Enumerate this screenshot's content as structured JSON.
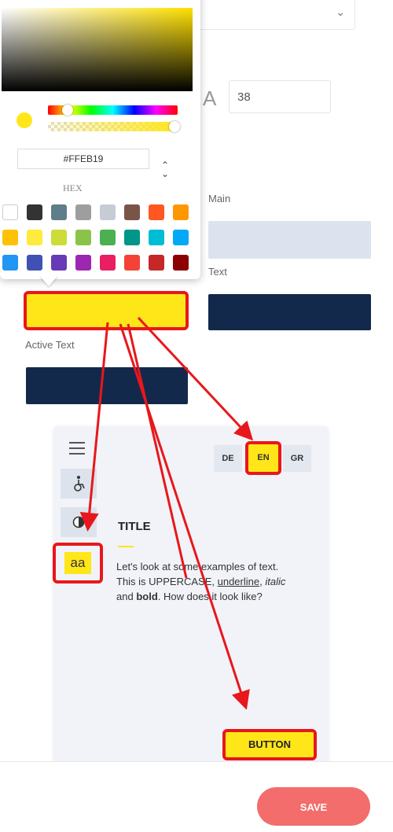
{
  "settings": {
    "size_icon_letter": "A",
    "size_value": "38",
    "labels": {
      "main": "Main",
      "text": "Text",
      "active_text": "Active Text"
    },
    "colors": {
      "active_background": "#ffe619",
      "main": "#dde3ee",
      "text": "#13294b",
      "active_text": "#13294b",
      "annotation_red": "#e8171b"
    }
  },
  "color_picker": {
    "hex_value": "#FFEB19",
    "mode_label": "HEX",
    "palette": [
      "#ffffff",
      "#333333",
      "#607d8b",
      "#9e9e9e",
      "#c5ccd3",
      "#795548",
      "#ff5722",
      "#ff9800",
      "#ffc107",
      "#ffeb3b",
      "#cddc39",
      "#8bc34a",
      "#4caf50",
      "#009688",
      "#00bcd4",
      "#03a9f4",
      "#2196f3",
      "#3f51b5",
      "#673ab7",
      "#9c27b0",
      "#e91e63",
      "#f44336",
      "#c62828",
      "#8b0000"
    ]
  },
  "preview": {
    "languages": [
      "DE",
      "EN",
      "GR"
    ],
    "active_language": "EN",
    "text_size_icon": "aa",
    "title": "TITLE",
    "paragraph": {
      "p1": "Let's look at some examples of text. This is UPPERCASE,",
      "underline": "underline",
      "comma": ",",
      "italic": "italic",
      "and": "and",
      "bold": "bold",
      "p2": ". How does it look like?"
    },
    "button_label": "BUTTON"
  },
  "footer": {
    "save_label": "SAVE"
  }
}
